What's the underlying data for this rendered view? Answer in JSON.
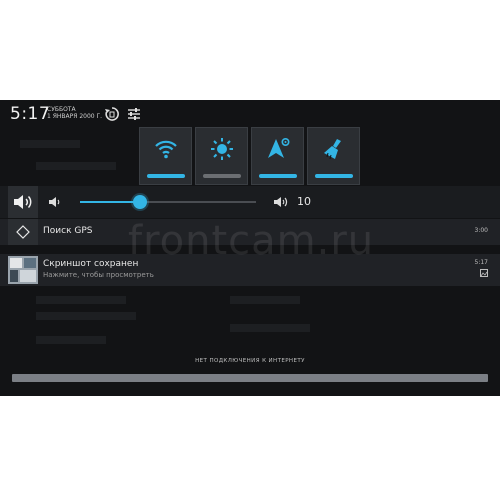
{
  "status_bar": {
    "time": "5:17",
    "day": "СУББОТА",
    "date": "1 ЯНВАРЯ 2000 Г."
  },
  "quick_settings": {
    "tiles": [
      {
        "name": "wifi-icon",
        "bar_color": "#33b5e5"
      },
      {
        "name": "brightness-icon",
        "bar_color": "#6b6e72"
      },
      {
        "name": "gps-settings-icon",
        "bar_color": "#33b5e5"
      },
      {
        "name": "cleaner-icon",
        "bar_color": "#33b5e5"
      }
    ]
  },
  "volume": {
    "value": "10",
    "level_fraction": 0.34
  },
  "notifications": [
    {
      "title": "Поиск GPS",
      "subtitle": "",
      "time": "3:00"
    },
    {
      "title": "Скриншот сохранен",
      "subtitle": "Нажмите, чтобы просмотреть",
      "time": "5:17"
    }
  ],
  "footer": {
    "no_internet": "НЕТ ПОДКЛЮЧЕНИЯ К ИНТЕРНЕТУ"
  },
  "watermark": "frontcam.ru",
  "colors": {
    "accent": "#33b5e5",
    "background": "#121315",
    "panel": "#202226"
  }
}
